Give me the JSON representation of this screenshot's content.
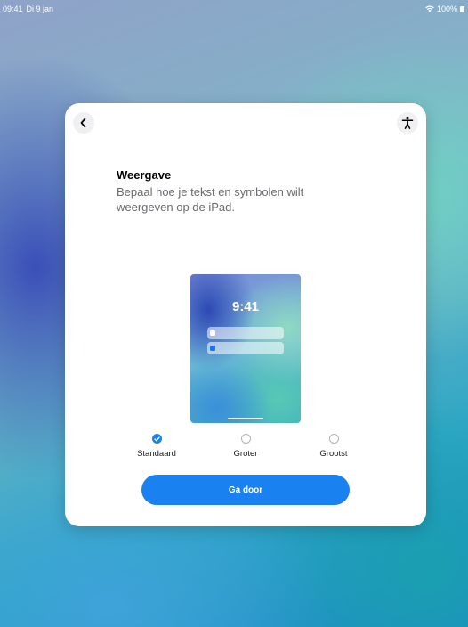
{
  "status_bar": {
    "time": "09:41",
    "date": "Di 9 jan",
    "battery": "100%"
  },
  "sheet": {
    "back_icon": "chevron-left-icon",
    "accessibility_icon": "accessibility-person-icon",
    "title": "Weergave",
    "subtitle": "Bepaal hoe je tekst en symbolen wilt weergeven op de iPad.",
    "preview": {
      "time": "9:41"
    },
    "options": [
      {
        "label": "Standaard",
        "selected": true
      },
      {
        "label": "Groter",
        "selected": false
      },
      {
        "label": "Grootst",
        "selected": false
      }
    ],
    "continue_label": "Ga door"
  },
  "colors": {
    "accent": "#1a82f0",
    "sheet_bg": "#ffffff",
    "subtitle": "#6b6b70"
  }
}
